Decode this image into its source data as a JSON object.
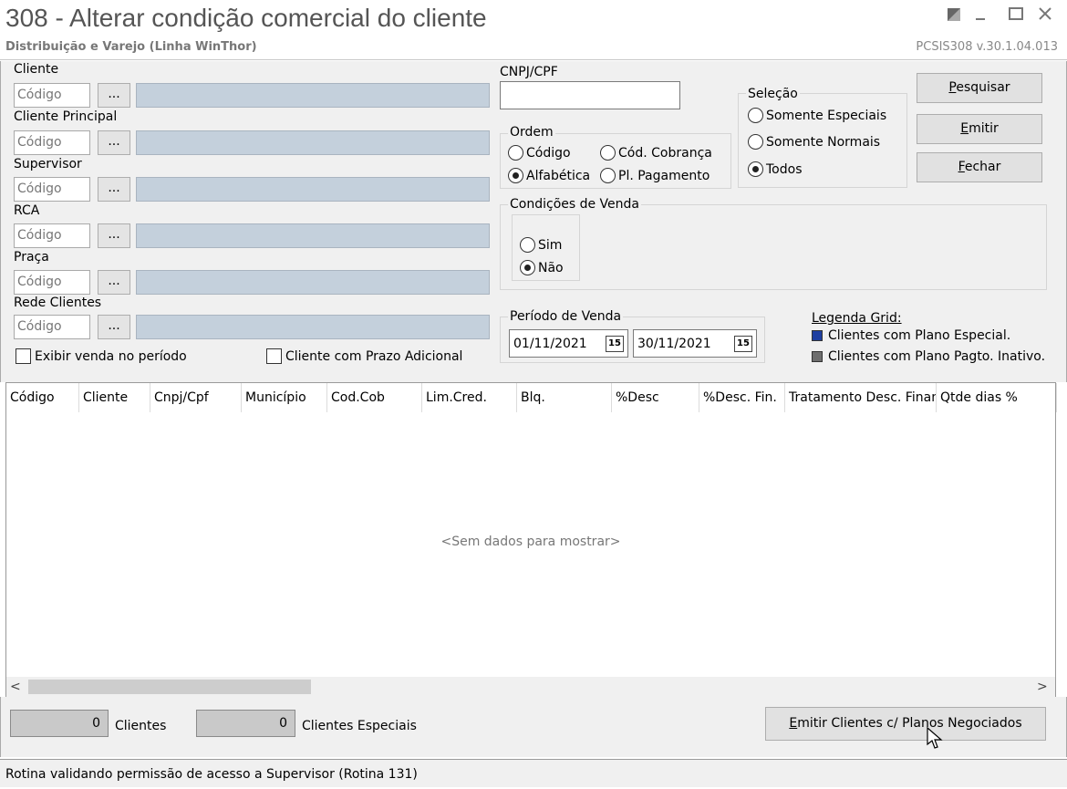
{
  "window": {
    "title": "308 - Alterar condição comercial do cliente",
    "subtitle": "Distribuição e Varejo (Linha WinThor)",
    "version": "PCSIS308  v.30.1.04.013"
  },
  "filters": {
    "code_placeholder": "Código",
    "browse_label": "...",
    "cliente_label": "Cliente",
    "cliente_principal_label": "Cliente Principal",
    "supervisor_label": "Supervisor",
    "rca_label": "RCA",
    "praca_label": "Praça",
    "rede_clientes_label": "Rede Clientes",
    "cnpj_label": "CNPJ/CPF",
    "cnpj_value": "",
    "exibir_venda_label": "Exibir venda no período",
    "prazo_adicional_label": "Cliente com Prazo Adicional"
  },
  "ordem": {
    "title": "Ordem",
    "codigo": "Código",
    "cod_cobranca": "Cód. Cobrança",
    "alfabetica": "Alfabética",
    "pl_pagamento": "Pl. Pagamento"
  },
  "selecao": {
    "title": "Seleção",
    "somente_especiais": "Somente Especiais",
    "somente_normais": "Somente Normais",
    "todos": "Todos"
  },
  "condicoes": {
    "title": "Condições de Venda",
    "sim": "Sim",
    "nao": "Não"
  },
  "periodo": {
    "title": "Período de Venda",
    "start": "01/11/2021",
    "end": "30/11/2021",
    "cal_icon": "15"
  },
  "legend": {
    "title": "Legenda Grid:",
    "especial": "Clientes com Plano Especial.",
    "inativo": "Clientes com Plano Pagto. Inativo.",
    "especial_color": "#1f3fa0",
    "inativo_color": "#6e6e6e"
  },
  "buttons": {
    "pesquisar_u": "P",
    "pesquisar_rest": "esquisar",
    "emitir_u": "E",
    "emitir_rest": "mitir",
    "fechar_u": "F",
    "fechar_rest": "echar",
    "emitir_planos_u": "E",
    "emitir_planos_rest": "mitir Clientes c/ Planos Negociados"
  },
  "grid": {
    "columns": [
      "Código",
      "Cliente",
      "Cnpj/Cpf",
      "Município",
      "Cod.Cob",
      "Lim.Cred.",
      "Blq.",
      "%Desc",
      "%Desc. Fin.",
      "Tratamento Desc. Financeir",
      "Qtde dias %"
    ],
    "empty_text": "<Sem dados para mostrar>",
    "scroll_left": "<",
    "scroll_right": ">"
  },
  "counters": {
    "clientes_value": "0",
    "clientes_label": "Clientes",
    "especiais_value": "0",
    "especiais_label": "Clientes Especiais"
  },
  "status": {
    "text": "Rotina validando permissão de acesso a Supervisor (Rotina 131)"
  }
}
